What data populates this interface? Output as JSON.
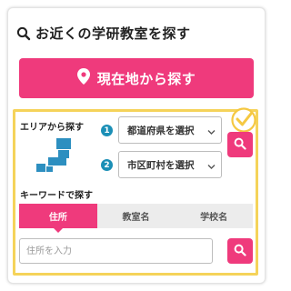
{
  "header": {
    "title": "お近くの学研教室を探す",
    "icon": "search-icon"
  },
  "location_button": {
    "label": "現在地から探す",
    "icon": "location-pin-icon"
  },
  "area_search": {
    "label": "エリアから探す",
    "steps": [
      {
        "number": "1",
        "select_value": "都道府県を選択"
      },
      {
        "number": "2",
        "select_value": "市区町村を選択"
      }
    ]
  },
  "keyword_search": {
    "label": "キーワードで探す",
    "tabs": [
      {
        "label": "住所",
        "active": true
      },
      {
        "label": "教室名",
        "active": false
      },
      {
        "label": "学校名",
        "active": false
      }
    ],
    "input": {
      "placeholder": "住所を入力",
      "value": ""
    }
  },
  "colors": {
    "accent": "#ef3a7c",
    "step_badge": "#1b8fb6",
    "highlight_border": "#f5d35a",
    "map_icon": "#2d8fc0"
  }
}
